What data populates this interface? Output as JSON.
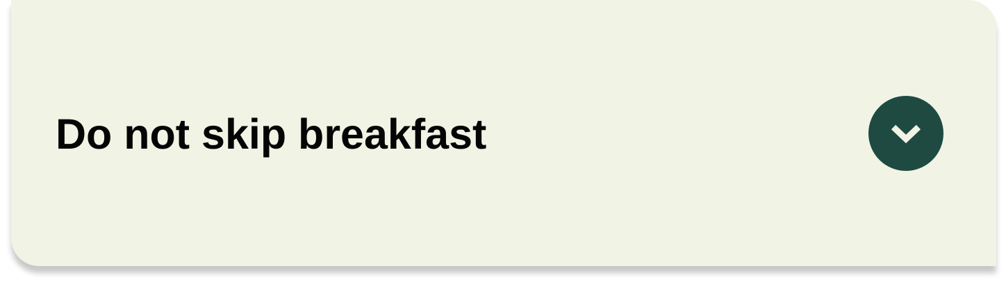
{
  "faq": {
    "item": {
      "question": "Do not skip breakfast",
      "expanded": false,
      "toggle_icon": "chevron-down-icon"
    }
  },
  "colors": {
    "card_background": "#f1f3e4",
    "toggle_background": "#1e4a42",
    "chevron": "#f1f3e4",
    "text": "#050505"
  }
}
